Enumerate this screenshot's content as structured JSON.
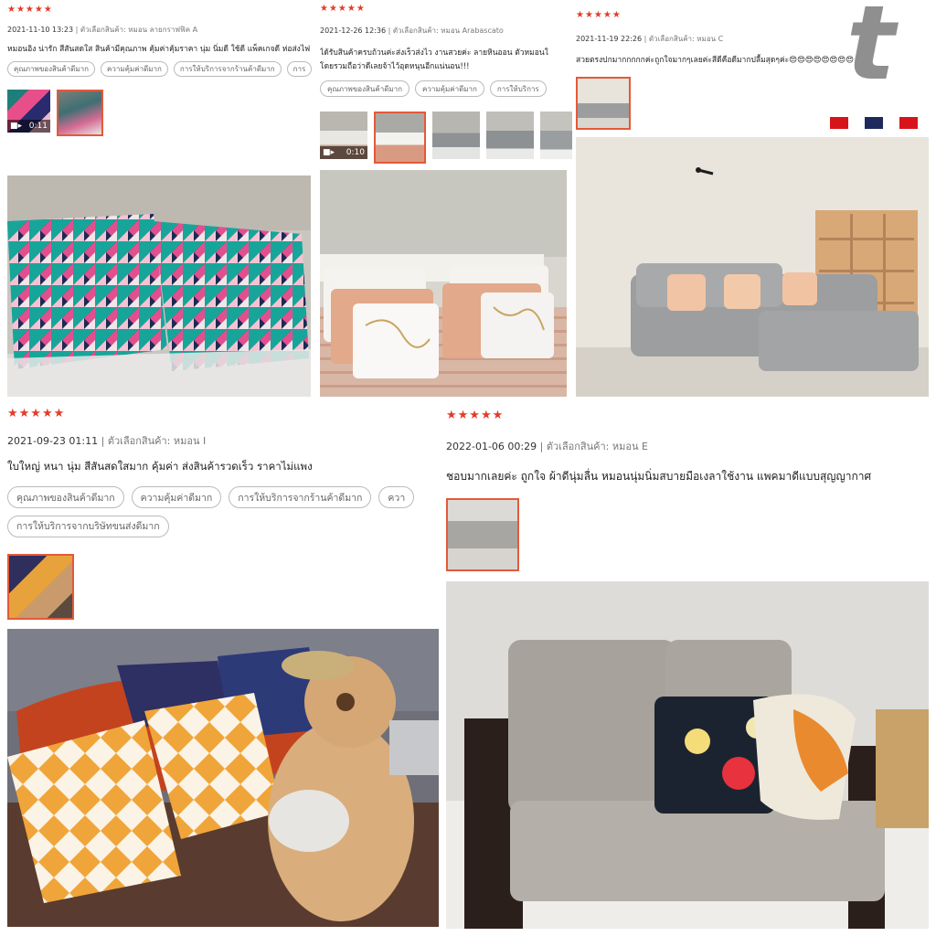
{
  "reviews": [
    {
      "stars": "★★★★★",
      "date": "2021-11-10 13:23",
      "variant": "| ตัวเลือกสินค้า: หมอน ลายกราฟฟิค A",
      "text": "หมอนอิง น่ารัก สีสันสดใส สินค้ามีคุณภาพ คุ้มค่าคุ้มราคา นุ่ม นิ่มดี ใช้ดี แพ็คเกจดี ห่อส่งไฟ",
      "tags": [
        "คุณภาพของสินค้าดีมาก",
        "ความคุ้มค่าดีมาก",
        "การให้บริการจากร้านค้าดีมาก",
        "การ"
      ],
      "video_duration": "0:11"
    },
    {
      "stars": "★★★★★",
      "date": "2021-12-26 12:36",
      "variant": "| ตัวเลือกสินค้า: หมอน Arabascato",
      "text_line1": "ได้รับสินค้าครบถ้วนค่ะส่งเร็วส่งไว งานสวยค่ะ ลายหินออน ตัวหมอนใ",
      "text_line2": "โดยรวมถือว่าดีเลยจ้าไว้อุดหนุนอีกแน่นอน!!!",
      "tags": [
        "คุณภาพของสินค้าดีมาก",
        "ความคุ้มค่าดีมาก",
        "การให้บริการ"
      ],
      "video_duration": "0:10"
    },
    {
      "stars": "★★★★★",
      "date": "2021-11-19 22:26",
      "variant": "| ตัวเลือกสินค้า: หมอน C",
      "text": "สวยตรงปกมากกกกกค่ะถูกใจมากๆเลยค่ะสีดีคือดีมากปลื้มสุดๆค่ะ😍😍😍😍😍😍😍😍"
    },
    {
      "stars": "★★★★★",
      "date": "2021-09-23 01:11",
      "variant": "| ตัวเลือกสินค้า: หมอน I",
      "text": "ใบใหญ่ หนา นุ่ม สีสันสดใสมาก  คุ้มค่า ส่งสินค้ารวดเร็ว  ราคาไม่แพง",
      "tags": [
        "คุณภาพของสินค้าดีมาก",
        "ความคุ้มค่าดีมาก",
        "การให้บริการจากร้านค้าดีมาก",
        "ควา",
        "การให้บริการจากบริษัทขนส่งดีมาก"
      ]
    },
    {
      "stars": "★★★★★",
      "date": "2022-01-06 00:29",
      "variant": "| ตัวเลือกสินค้า: หมอน E",
      "text": "ชอบมากเลยค่ะ ถูกใจ ผ้าดีนุ่มลื่น หมอนนุ่มนิ่มสบายมือเงลาใช้งาน แพคมาดีแบบสุญญากาศ"
    }
  ],
  "watermark": "t",
  "colors": {
    "star": "#e23b2a",
    "selected_border": "#e25a3a",
    "flag_red": "#d7141a",
    "flag_navy": "#1f2a5c"
  },
  "icons": [
    "video-camera-icon",
    "brand-logo-t"
  ]
}
